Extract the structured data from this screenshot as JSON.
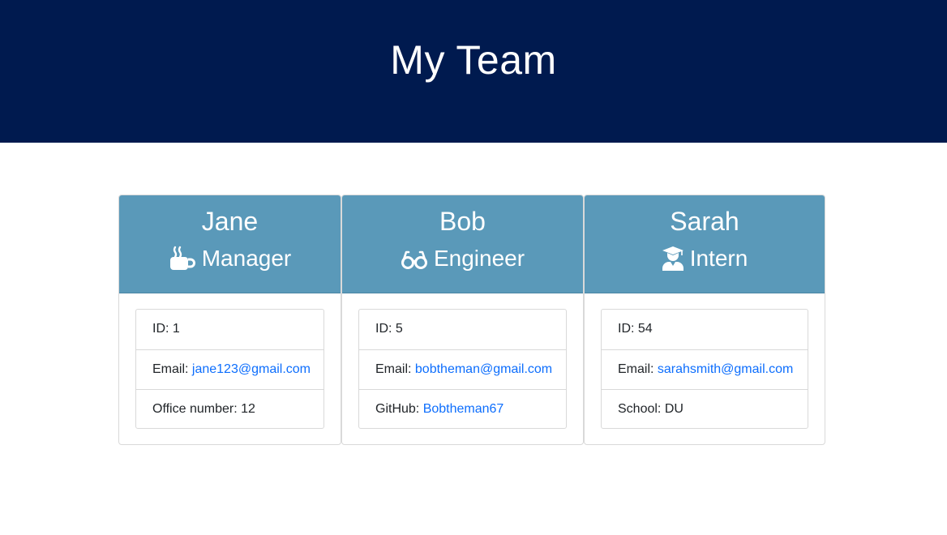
{
  "page": {
    "title": "My Team",
    "colors": {
      "header_bg": "#001a4f",
      "card_head_bg": "#5a99b9",
      "link": "#0d6efd"
    }
  },
  "team": [
    {
      "name": "Jane",
      "role": "Manager",
      "role_icon": "mug-hot-icon",
      "id_text": "ID: 1",
      "email_label": "Email: ",
      "email": "jane123@gmail.com",
      "extra_label": "Office number: 12",
      "extra_link": ""
    },
    {
      "name": "Bob",
      "role": "Engineer",
      "role_icon": "glasses-icon",
      "id_text": "ID: 5",
      "email_label": "Email: ",
      "email": "bobtheman@gmail.com",
      "extra_label": "GitHub: ",
      "extra_link": "Bobtheman67"
    },
    {
      "name": "Sarah",
      "role": "Intern",
      "role_icon": "user-graduate-icon",
      "id_text": "ID: 54",
      "email_label": "Email: ",
      "email": "sarahsmith@gmail.com",
      "extra_label": "School: DU",
      "extra_link": ""
    }
  ]
}
